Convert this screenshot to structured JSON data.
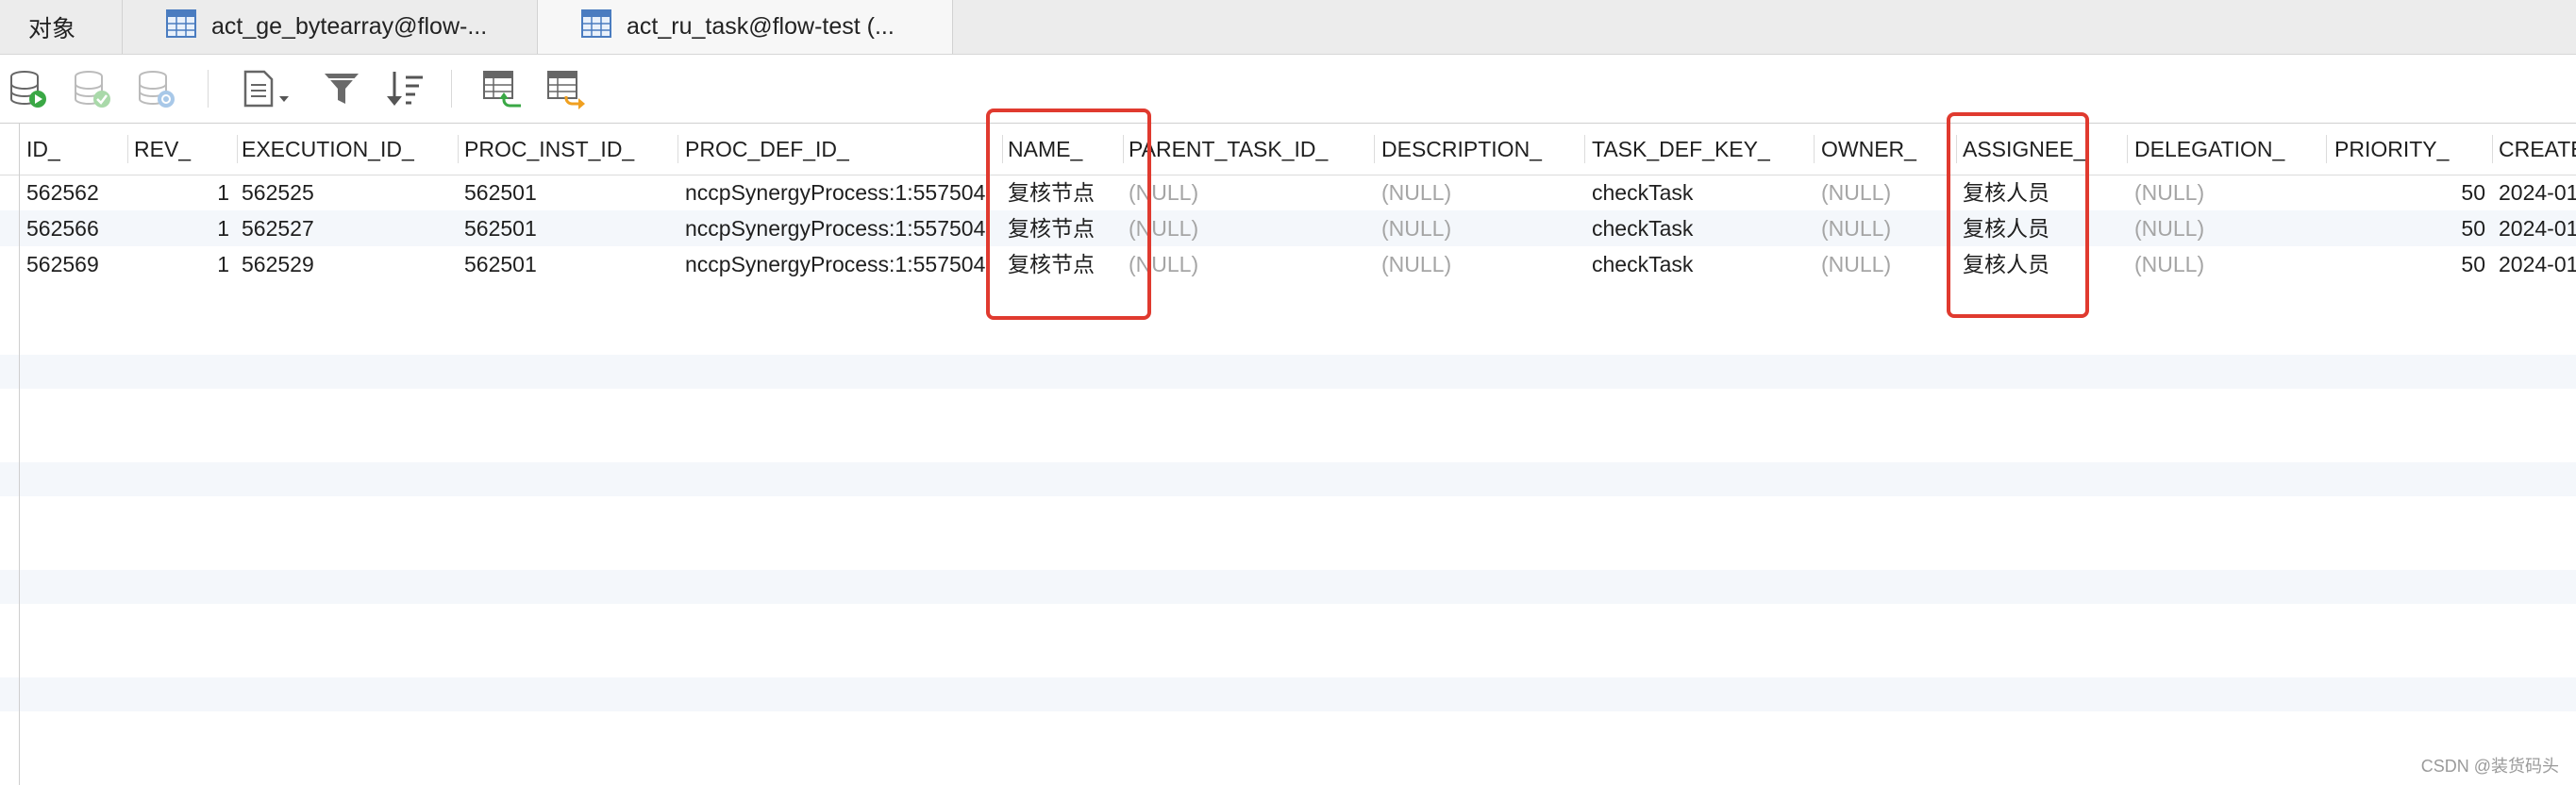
{
  "tabs": [
    {
      "label": "对象",
      "active": false
    },
    {
      "label": "act_ge_bytearray@flow-...",
      "active": false
    },
    {
      "label": "act_ru_task@flow-test (...",
      "active": true
    }
  ],
  "toolbar": {
    "buttons": [
      "begin-transaction-icon",
      "commit-icon",
      "rollback-icon",
      "text-view-icon",
      "filter-icon",
      "sort-icon",
      "import-icon",
      "export-icon"
    ]
  },
  "columns": [
    "ID_",
    "REV_",
    "EXECUTION_ID_",
    "PROC_INST_ID_",
    "PROC_DEF_ID_",
    "NAME_",
    "PARENT_TASK_ID_",
    "DESCRIPTION_",
    "TASK_DEF_KEY_",
    "OWNER_",
    "ASSIGNEE_",
    "DELEGATION_",
    "PRIORITY_",
    "CREATE"
  ],
  "rows": [
    [
      "562562",
      "1",
      "562525",
      "562501",
      "nccpSynergyProcess:1:557504",
      "复核节点",
      "(NULL)",
      "(NULL)",
      "checkTask",
      "(NULL)",
      "复核人员",
      "(NULL)",
      "50",
      "2024-01"
    ],
    [
      "562566",
      "1",
      "562527",
      "562501",
      "nccpSynergyProcess:1:557504",
      "复核节点",
      "(NULL)",
      "(NULL)",
      "checkTask",
      "(NULL)",
      "复核人员",
      "(NULL)",
      "50",
      "2024-01"
    ],
    [
      "562569",
      "1",
      "562529",
      "562501",
      "nccpSynergyProcess:1:557504",
      "复核节点",
      "(NULL)",
      "(NULL)",
      "checkTask",
      "(NULL)",
      "复核人员",
      "(NULL)",
      "50",
      "2024-01"
    ]
  ],
  "watermark": "CSDN @装货码头",
  "colors": {
    "highlight": "#e03a2f",
    "null_text": "#a5a5a5",
    "row_stripe": "#f4f7fb"
  }
}
